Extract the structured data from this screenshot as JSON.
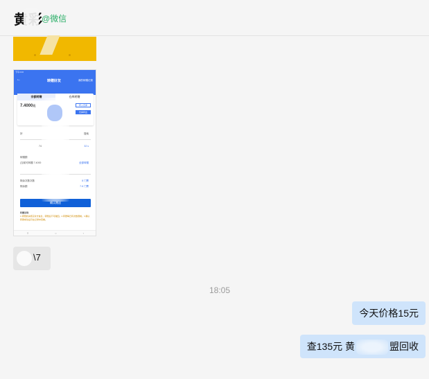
{
  "header": {
    "contact_name": "黄彩",
    "contact_source": "@微信"
  },
  "screenshot": {
    "status_time": "下午4:13",
    "title": "转赠好友",
    "title_right": "我的转赠记录",
    "tab_left": "余额转赠",
    "tab_right": "仓库转赠",
    "amount": "7.4000",
    "amount_unit": "元",
    "transfer_in": "转入仓库",
    "transfer_out": "仓库转出",
    "row_label_1": "好",
    "row_value_1": "74",
    "row_search": "搜索",
    "row_right_1": "32 s",
    "row_label_2": "转赠额",
    "row_label_3": "(当前可转赠 7.4000",
    "row_right_3": "全部转赠",
    "row_label_4": "剩余次数次数",
    "row_right_4": "8 门票",
    "row_label_5": "剩余额",
    "row_right_5": "7.6 门票",
    "confirm": "确认赠送",
    "tips_title": "转赠说明:",
    "tips": "1.转赠前请核实对方信息，转赠后不可撤回。2.转赠每日有次数限制。3.确认转赠成功后可在记录中查看。"
  },
  "messages": {
    "incoming_small": "\\7",
    "timestamp": "18:05",
    "outgoing_1": "今天价格15元",
    "outgoing_2_pre": "查135元 黄",
    "outgoing_2_post": "盟回收"
  }
}
